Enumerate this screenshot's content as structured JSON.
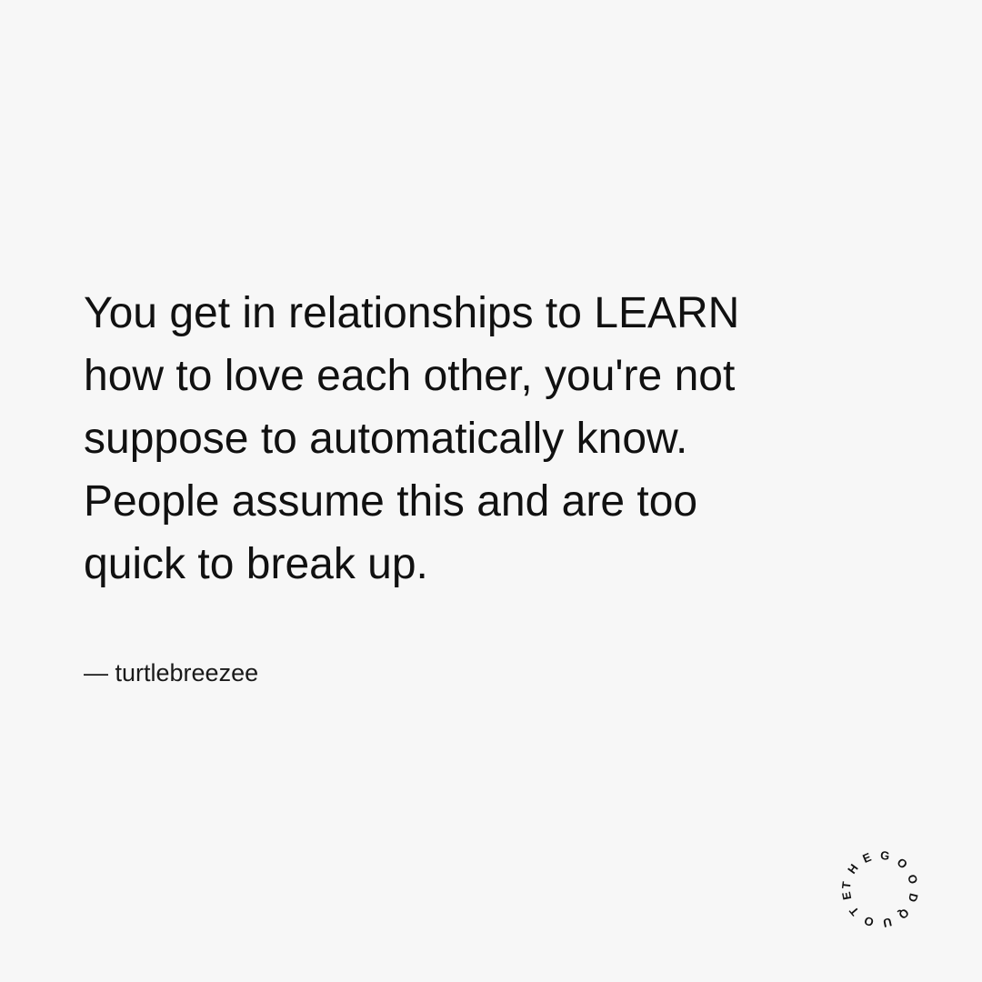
{
  "quote": {
    "lines": [
      "You get in relationships to LEARN",
      "how to love each other, you're not",
      "suppose to automatically know.",
      "People assume this and are too",
      "quick to break up."
    ],
    "attribution": "— turtlebreezee"
  },
  "logo": {
    "circular_text": "THEGOODQUOTE"
  },
  "colors": {
    "background": "#f7f7f7",
    "text": "#111111"
  }
}
